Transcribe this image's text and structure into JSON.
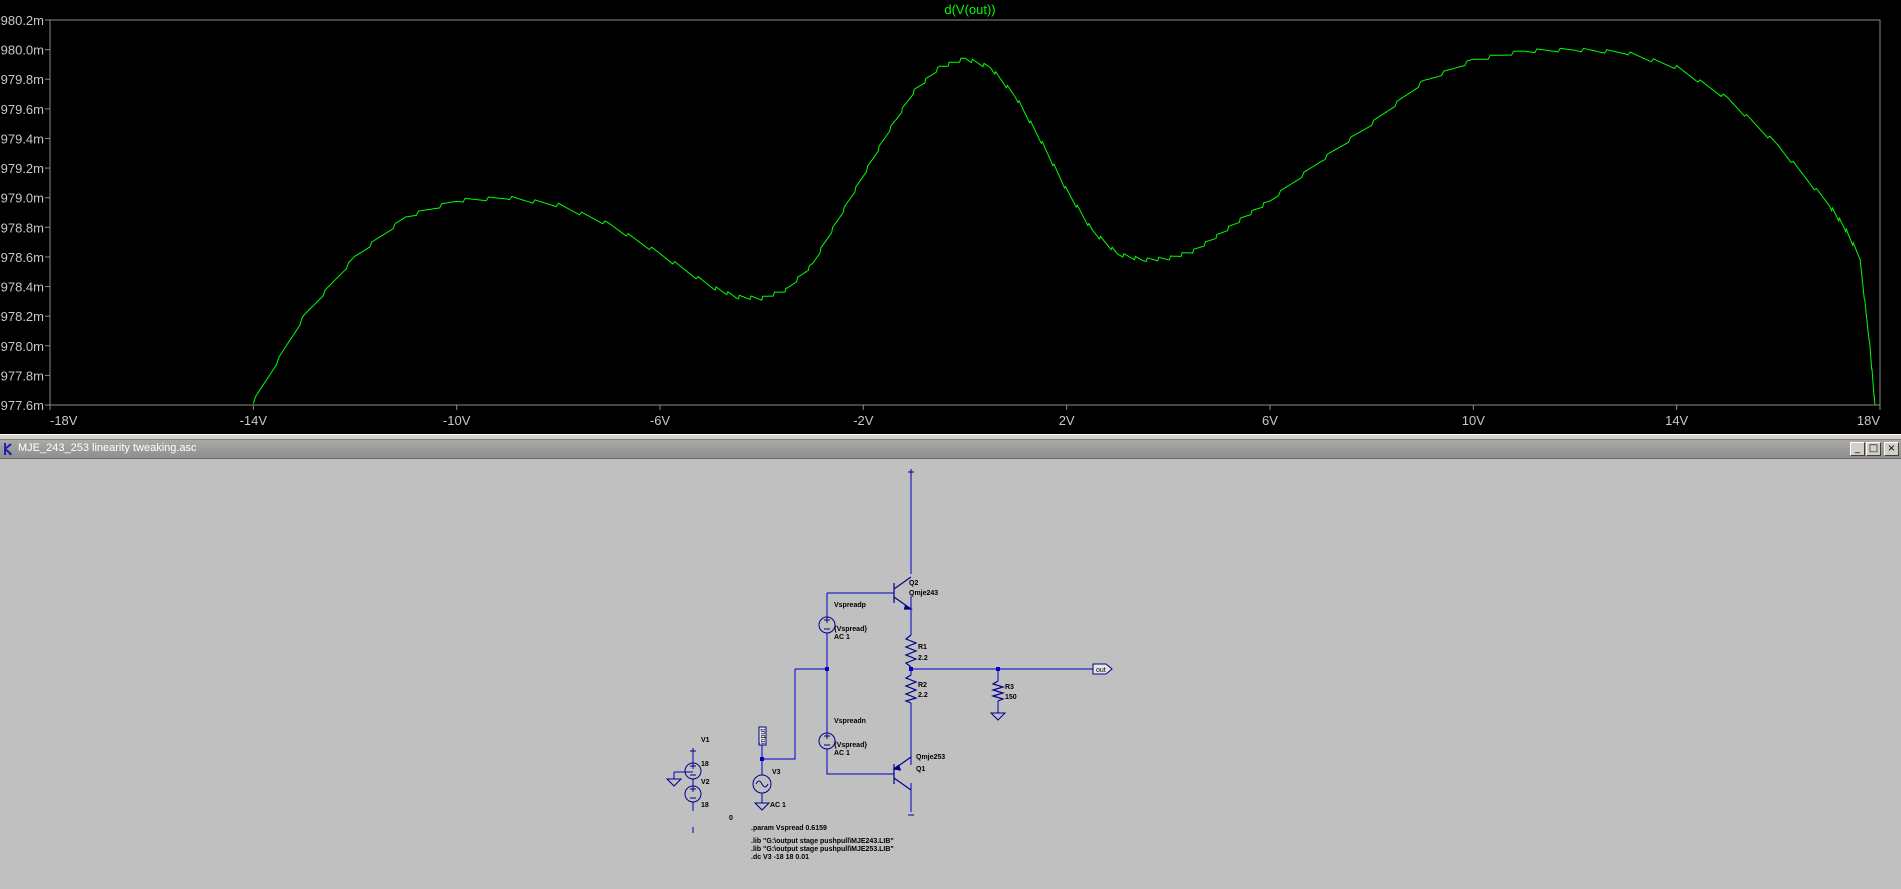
{
  "chart_data": {
    "type": "line",
    "title": "d(V(out))",
    "xlabel": "",
    "ylabel": "",
    "xlim": [
      -18,
      18
    ],
    "ylim": [
      977.6,
      980.2
    ],
    "x_ticks": [
      "-18V",
      "-14V",
      "-10V",
      "-6V",
      "-2V",
      "2V",
      "6V",
      "10V",
      "14V",
      "18V"
    ],
    "y_ticks": [
      "980.2m",
      "980.0m",
      "979.8m",
      "979.6m",
      "979.4m",
      "979.2m",
      "979.0m",
      "978.8m",
      "978.6m",
      "978.4m",
      "978.2m",
      "978.0m",
      "977.8m",
      "977.6m"
    ],
    "grid": false,
    "series": [
      {
        "name": "",
        "color": "#00ff00",
        "x": [
          -14.0,
          -13.0,
          -12.0,
          -11.0,
          -10.0,
          -9.0,
          -8.0,
          -7.0,
          -6.0,
          -5.0,
          -4.5,
          -4.0,
          -3.5,
          -3.0,
          -2.5,
          -2.0,
          -1.5,
          -1.0,
          -0.5,
          0.0,
          0.5,
          1.0,
          1.5,
          2.0,
          2.5,
          3.0,
          3.5,
          4.0,
          4.5,
          5.0,
          5.5,
          6.0,
          7.0,
          8.0,
          9.0,
          10.0,
          11.0,
          12.0,
          13.0,
          14.0,
          15.0,
          16.0,
          17.0,
          17.3,
          17.6,
          17.8,
          17.9
        ],
        "y": [
          977.62,
          978.2,
          978.6,
          978.87,
          978.98,
          979.0,
          978.95,
          978.82,
          978.62,
          978.4,
          978.33,
          978.32,
          978.38,
          978.55,
          978.85,
          979.15,
          979.45,
          979.72,
          979.88,
          979.94,
          979.88,
          979.68,
          979.38,
          979.05,
          978.78,
          978.62,
          978.58,
          978.59,
          978.64,
          978.75,
          978.87,
          978.98,
          979.25,
          979.5,
          979.78,
          979.93,
          979.99,
          980.0,
          979.98,
          979.88,
          979.67,
          979.35,
          978.95,
          978.8,
          978.6,
          978.0,
          977.6
        ]
      }
    ]
  },
  "window": {
    "title": "MJE_243_253 linearity tweaking.asc",
    "minimize": "_",
    "maximize": "□",
    "close": "×"
  },
  "schematic": {
    "q2_name": "Q2",
    "q2_model": "Qmje243",
    "q1_name": "Q1",
    "q1_model": "Qmje253",
    "vspreadp_name": "Vspreadp",
    "vspreadp_value": "{Vspread}",
    "vspreadp_ac": "AC 1",
    "vspreadn_name": "Vspreadn",
    "vspreadn_value": "{Vspread}",
    "vspreadn_ac": "AC 1",
    "r1_name": "R1",
    "r1_value": "2.2",
    "r2_name": "R2",
    "r2_value": "2.2",
    "r3_name": "R3",
    "r3_value": "150",
    "v1_name": "V1",
    "v1_value": "18",
    "v2_name": "V2",
    "v2_value": "18",
    "v3_name": "V3",
    "v3_ac": "AC 1",
    "out_label": "out",
    "input_label": "input",
    "zero_label": "0",
    "directive_param": ".param Vspread 0.6159",
    "directive_lib1": ".lib \"G:\\output stage pushpull\\MJE243.LIB\"",
    "directive_lib2": ".lib \"G:\\output stage pushpull\\MJE253.LIB\"",
    "directive_dc": ".dc V3 -18 18 0.01",
    "wire_color": "#0000c8",
    "component_color": "#00008b"
  }
}
